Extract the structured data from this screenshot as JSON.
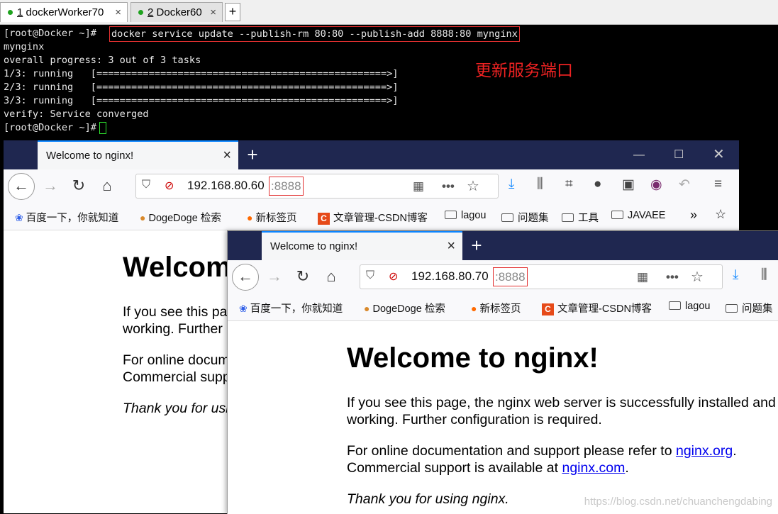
{
  "terminal_tabs": [
    {
      "number": "1",
      "label": "dockerWorker70",
      "close": "×"
    },
    {
      "number": "2",
      "label": "Docker60",
      "close": "×"
    }
  ],
  "terminal_add_tab": "+",
  "terminal": {
    "prompt": "[root@Docker ~]#",
    "command": "docker service update --publish-rm 80:80 --publish-add 8888:80 mynginx",
    "output": [
      "mynginx",
      "overall progress: 3 out of 3 tasks",
      "1/3: running   [==================================================>]",
      "2/3: running   [==================================================>]",
      "3/3: running   [==================================================>]",
      "verify: Service converged"
    ],
    "last_prompt": "[root@Docker ~]#"
  },
  "annotation": "更新服务端口",
  "bookmarks": [
    "百度一下，你就知道",
    "DogeDoge 检索",
    "新标签页",
    "文章管理-CSDN博客",
    "lagou",
    "问题集",
    "工具",
    "JAVAEE"
  ],
  "browser1": {
    "tab_title": "Welcome to nginx!",
    "url_host": "192.168.80.60",
    "url_port": ":8888"
  },
  "browser2": {
    "tab_title": "Welcome to nginx!",
    "url_host": "192.168.80.70",
    "url_port": ":8888"
  },
  "nginx_page": {
    "heading": "Welcome to nginx!",
    "p1_line1": "If you see this page, the nginx web server is successfully installed and",
    "p1_line2": "working. Further configuration is required.",
    "p2_line1_pre": "For online documentation and support please refer to ",
    "p2_link1": "nginx.org",
    "p2_line1_post": ".",
    "p2_line2_pre": "Commercial support is available at ",
    "p2_link2": "nginx.com",
    "p2_line2_post": ".",
    "p3": "Thank you for using nginx."
  },
  "watermark": "https://blog.csdn.net/chuanchengdabing",
  "icons": [
    "back-icon",
    "forward-icon",
    "reload-icon",
    "home-icon",
    "shield-icon",
    "insecure-lock-icon",
    "qr-code-icon",
    "more-icon",
    "star-icon",
    "download-icon",
    "library-icon",
    "screenshot-icon",
    "chat-icon",
    "reader-icon",
    "avatar-icon",
    "undo-icon",
    "menu-icon"
  ],
  "colors": {
    "terminal_bg": "#000000",
    "highlight_red": "#e23030",
    "cursor_green": "#2ee02e",
    "browser_tabbar": "#1f2750"
  }
}
